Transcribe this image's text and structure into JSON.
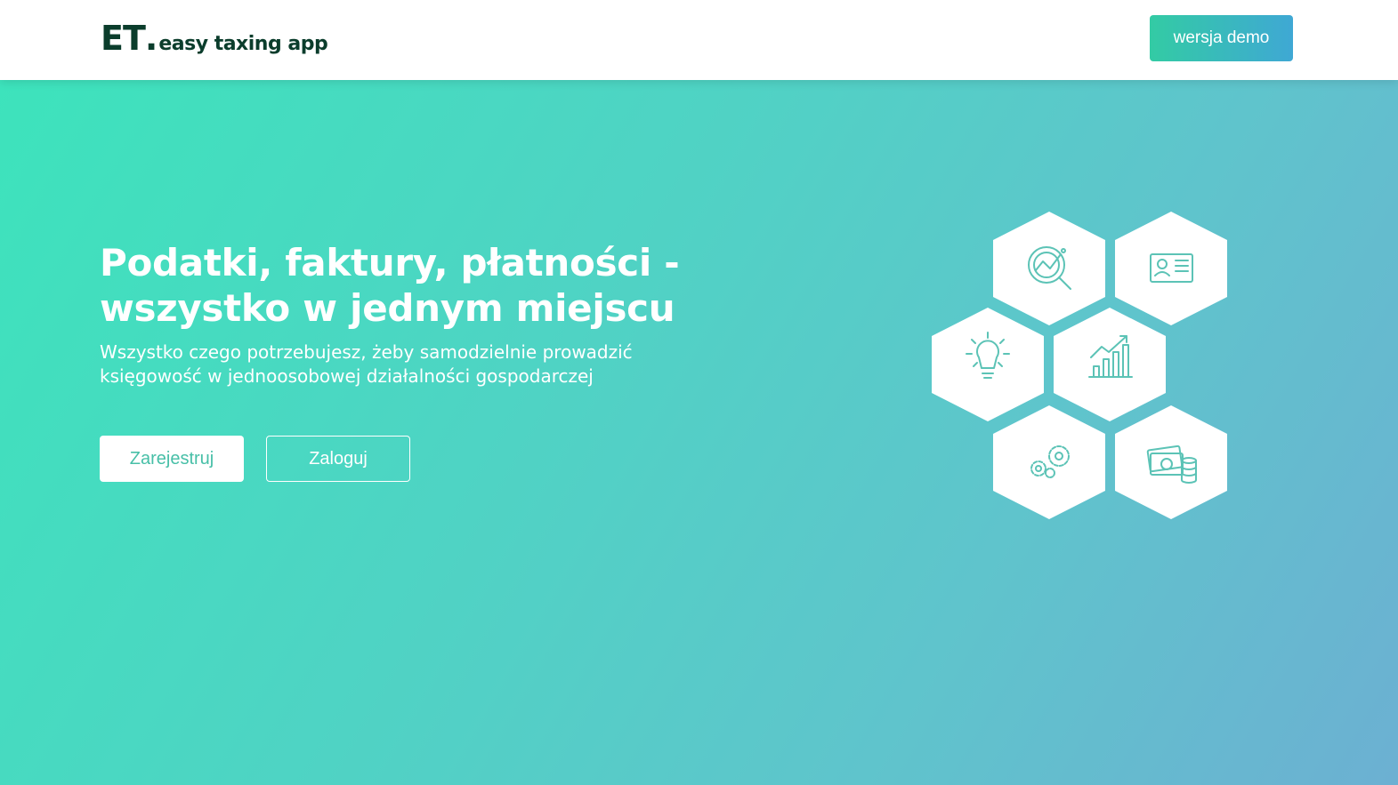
{
  "navbar": {
    "logo_mark": "ET",
    "logo_dot": ".",
    "logo_text": "easy taxing app",
    "demo_button": "wersja demo"
  },
  "hero": {
    "headline": "Podatki, faktury, płatności - wszystko w jednym miejscu",
    "subtext": "Wszystko czego potrzebujesz, żeby samodzielnie prowadzić księgowość w jednoosobowej działalności gospodarczej",
    "register_button": "Zarejestruj",
    "login_button": "Zaloguj"
  },
  "feature_icons": [
    "analytics-search-icon",
    "id-card-icon",
    "lightbulb-icon",
    "growth-chart-icon",
    "gears-icon",
    "money-coins-icon"
  ],
  "colors": {
    "logo": "#0b3d2c",
    "accent_start": "#3de3bc",
    "accent_end": "#6cb0d2",
    "icon_stroke": "#5cc3b6"
  }
}
